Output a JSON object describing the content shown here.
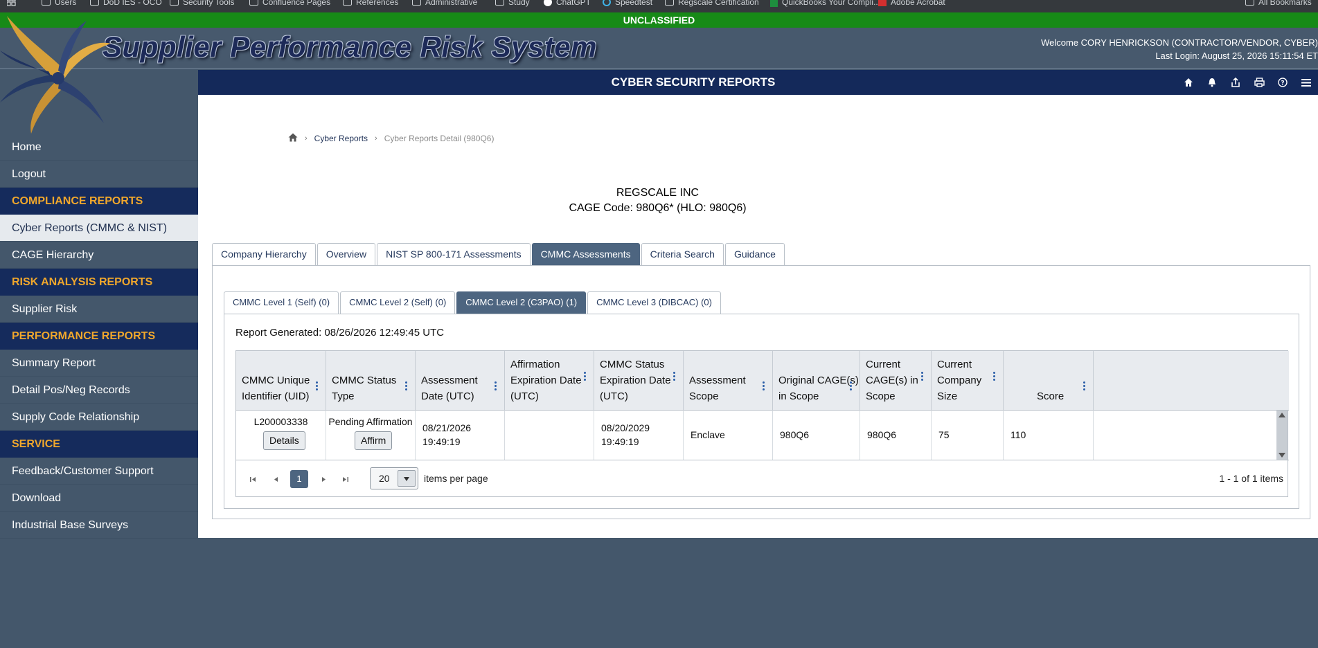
{
  "bookmarks": [
    "Bookmarks",
    "Users",
    "DoD IES - OCO",
    "Security Tools",
    "Confluence Pages",
    "References",
    "Administrative",
    "Study",
    "ChatGPT",
    "Speedtest",
    "Regscale Certification",
    "QuickBooks Your Compli...",
    "Adobe Acrobat",
    "All Bookmarks"
  ],
  "classification": "UNCLASSIFIED",
  "header": {
    "app_title": "Supplier Performance Risk System",
    "welcome": "Welcome CORY HENRICKSON (CONTRACTOR/VENDOR, CYBER)",
    "last_login": "Last Login: August 25, 2026 15:11:54 ET"
  },
  "page_title": "CYBER SECURITY REPORTS",
  "toolbar_icons": [
    "home-icon",
    "bell-icon",
    "share-icon",
    "print-icon",
    "help-icon",
    "menu-icon"
  ],
  "sidebar": {
    "home": "Home",
    "logout": "Logout",
    "compliance_head": "COMPLIANCE REPORTS",
    "cyber_reports": "Cyber Reports (CMMC & NIST)",
    "cage_hierarchy": "CAGE Hierarchy",
    "risk_head": "RISK ANALYSIS REPORTS",
    "supplier_risk": "Supplier Risk",
    "performance_head": "PERFORMANCE REPORTS",
    "summary_report": "Summary Report",
    "detail_records": "Detail Pos/Neg Records",
    "supply_code": "Supply Code Relationship",
    "service_head": "SERVICE",
    "feedback": "Feedback/Customer Support",
    "download": "Download",
    "surveys": "Industrial Base Surveys"
  },
  "breadcrumb": {
    "link": "Cyber Reports",
    "current": "Cyber Reports Detail (980Q6)"
  },
  "company": {
    "name": "REGSCALE INC",
    "cage": "CAGE Code: 980Q6* (HLO: 980Q6)"
  },
  "tabs": [
    "Company Hierarchy",
    "Overview",
    "NIST SP 800-171 Assessments",
    "CMMC Assessments",
    "Criteria Search",
    "Guidance"
  ],
  "subtabs": [
    "CMMC  Level 1 (Self) (0)",
    "CMMC  Level 2 (Self) (0)",
    "CMMC  Level 2 (C3PAO) (1)",
    "CMMC  Level 3 (DIBCAC) (0)"
  ],
  "report_generated": "Report Generated: 08/26/2026 12:49:45 UTC",
  "grid": {
    "headers": {
      "uid": [
        "CMMC Unique",
        "Identifier (UID)"
      ],
      "status": [
        "CMMC Status",
        "Type"
      ],
      "assessment_date": [
        "Assessment",
        "Date (UTC)"
      ],
      "affirmation": [
        "Affirmation",
        "Expiration Date",
        "(UTC)"
      ],
      "status_exp": [
        "CMMC Status",
        "Expiration Date",
        "(UTC)"
      ],
      "scope": [
        "Assessment",
        "Scope"
      ],
      "orig_cage": [
        "Original CAGE(s)",
        "in Scope"
      ],
      "curr_cage": [
        "Current",
        "CAGE(s) in",
        "Scope"
      ],
      "company_size": [
        "Current",
        "Company",
        "Size"
      ],
      "score": "Score"
    },
    "row": {
      "uid": "L200003338",
      "details_btn": "Details",
      "status": "Pending Affirmation",
      "affirm_btn": "Affirm",
      "assessment_date": [
        "08/21/2026",
        "19:49:19"
      ],
      "affirmation": "",
      "status_exp": [
        "08/20/2029",
        "19:49:19"
      ],
      "scope": "Enclave",
      "orig_cage": "980Q6",
      "curr_cage": "980Q6",
      "company_size": "75",
      "score": "110"
    }
  },
  "pager": {
    "page": "1",
    "page_size": "20",
    "items_label": "items per page",
    "info": "1 - 1 of 1 items"
  }
}
